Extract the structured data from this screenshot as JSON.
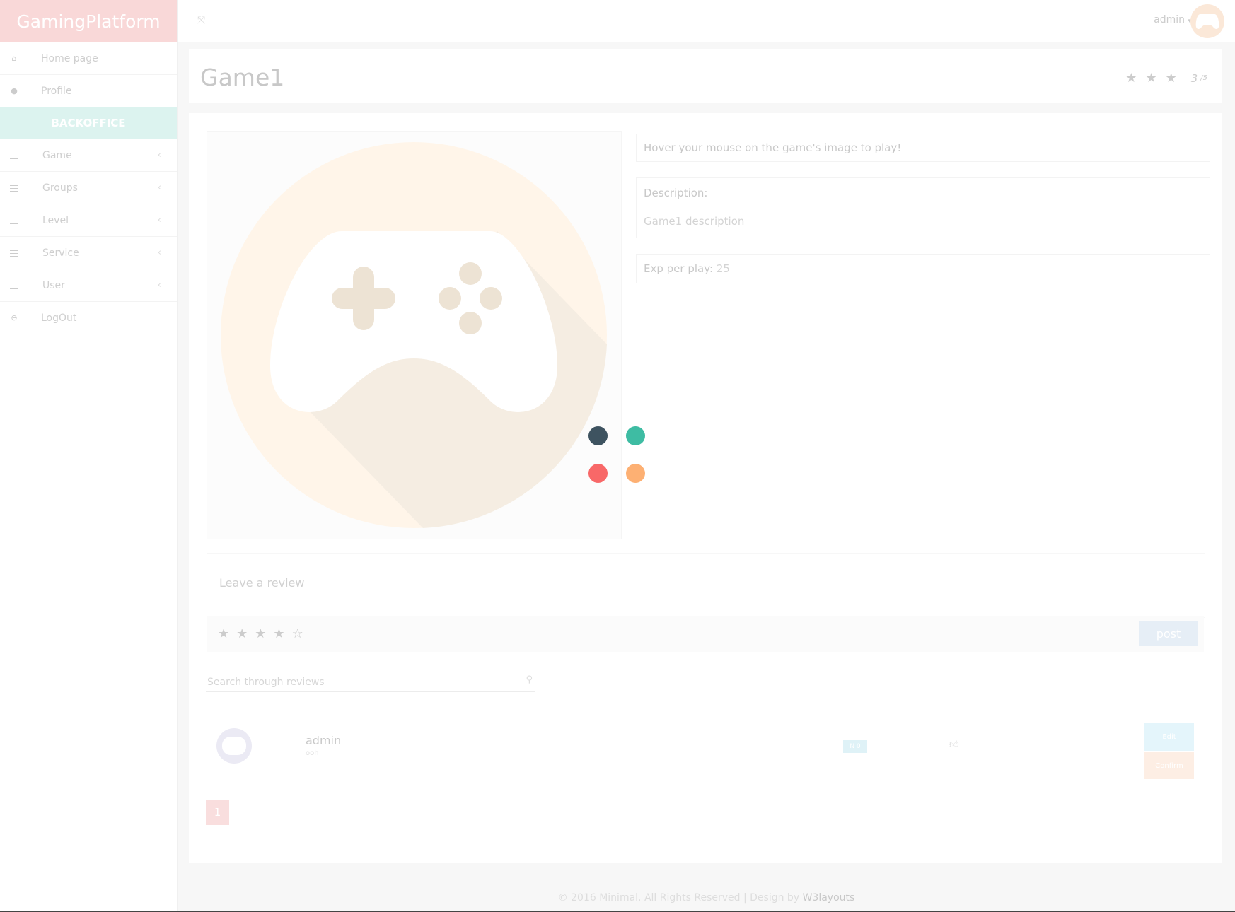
{
  "app": {
    "brand": "GamingPlatform"
  },
  "sidebar": {
    "items": [
      {
        "label": "Home page",
        "icon": "home-icon"
      },
      {
        "label": "Profile",
        "icon": "user-icon"
      }
    ],
    "section": "BACKOFFICE",
    "admin_items": [
      {
        "label": "Game",
        "icon": "sliders-icon"
      },
      {
        "label": "Groups",
        "icon": "sliders-icon"
      },
      {
        "label": "Level",
        "icon": "sliders-icon"
      },
      {
        "label": "Service",
        "icon": "sliders-icon"
      },
      {
        "label": "User",
        "icon": "sliders-icon"
      }
    ],
    "logout": {
      "label": "LogOut",
      "icon": "logout-icon"
    }
  },
  "topbar": {
    "user_label": "admin"
  },
  "game": {
    "title": "Game1",
    "rating": {
      "stars_filled": 3,
      "score": "3",
      "out_of": "/5"
    },
    "hover_note": "Hover your mouse on the game's image to play!",
    "description_label": "Description:",
    "description": "Game1 description",
    "exp_label": "Exp per play:",
    "exp_value": "25"
  },
  "loader": {
    "colors": [
      "#3e5360",
      "#3ebca3",
      "#f86868",
      "#fdb073"
    ]
  },
  "review_form": {
    "placeholder": "Leave a review",
    "stars_selected": 4,
    "stars_total": 5,
    "post_label": "post"
  },
  "search": {
    "placeholder": "Search through reviews"
  },
  "reviews": [
    {
      "author": "admin",
      "text": "ooh",
      "badge": "N 0",
      "edit_label": "Edit",
      "confirm_label": "Confirm"
    }
  ],
  "pagination": {
    "current": "1"
  },
  "footer": {
    "text": "© 2016 Minimal. All Rights Reserved | Design by ",
    "link": "W3layouts"
  }
}
